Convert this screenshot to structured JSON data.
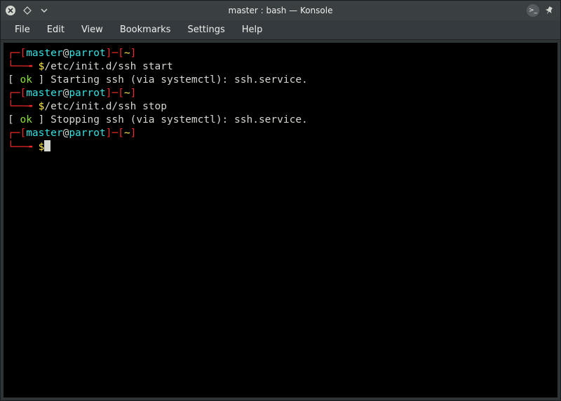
{
  "window": {
    "title": "master : bash — Konsole"
  },
  "menu": {
    "file": "File",
    "edit": "Edit",
    "view": "View",
    "bookmarks": "Bookmarks",
    "settings": "Settings",
    "help": "Help"
  },
  "term": {
    "p1_open": "┌─[",
    "p1_user": "master",
    "p1_at": "@",
    "p1_host": "parrot",
    "p1_close": "]─[",
    "p1_dir": "~",
    "p1_end": "]",
    "p1_arrow": "└──╼ ",
    "p1_dollar": "$",
    "cmd1": "/etc/init.d/ssh start",
    "out1_a": "[ ",
    "out1_ok": "ok",
    "out1_b": " ] Starting ssh (via systemctl): ssh.service.",
    "cmd2": "/etc/init.d/ssh stop",
    "out2_a": "[ ",
    "out2_ok": "ok",
    "out2_b": " ] Stopping ssh (via systemctl): ssh.service."
  }
}
